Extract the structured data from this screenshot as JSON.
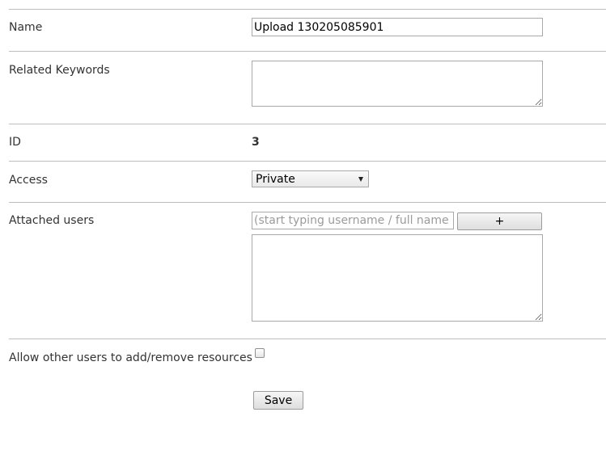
{
  "form": {
    "name": {
      "label": "Name",
      "value": "Upload 130205085901"
    },
    "related_keywords": {
      "label": "Related Keywords",
      "value": ""
    },
    "id": {
      "label": "ID",
      "value": "3"
    },
    "access": {
      "label": "Access",
      "selected": "Private"
    },
    "attached_users": {
      "label": "Attached users",
      "search_placeholder": "(start typing username / full name / group)",
      "add_label": "+",
      "list_value": ""
    },
    "allow_other_users": {
      "label": "Allow other users to add/remove resources",
      "checked": false
    },
    "save_label": "Save"
  }
}
